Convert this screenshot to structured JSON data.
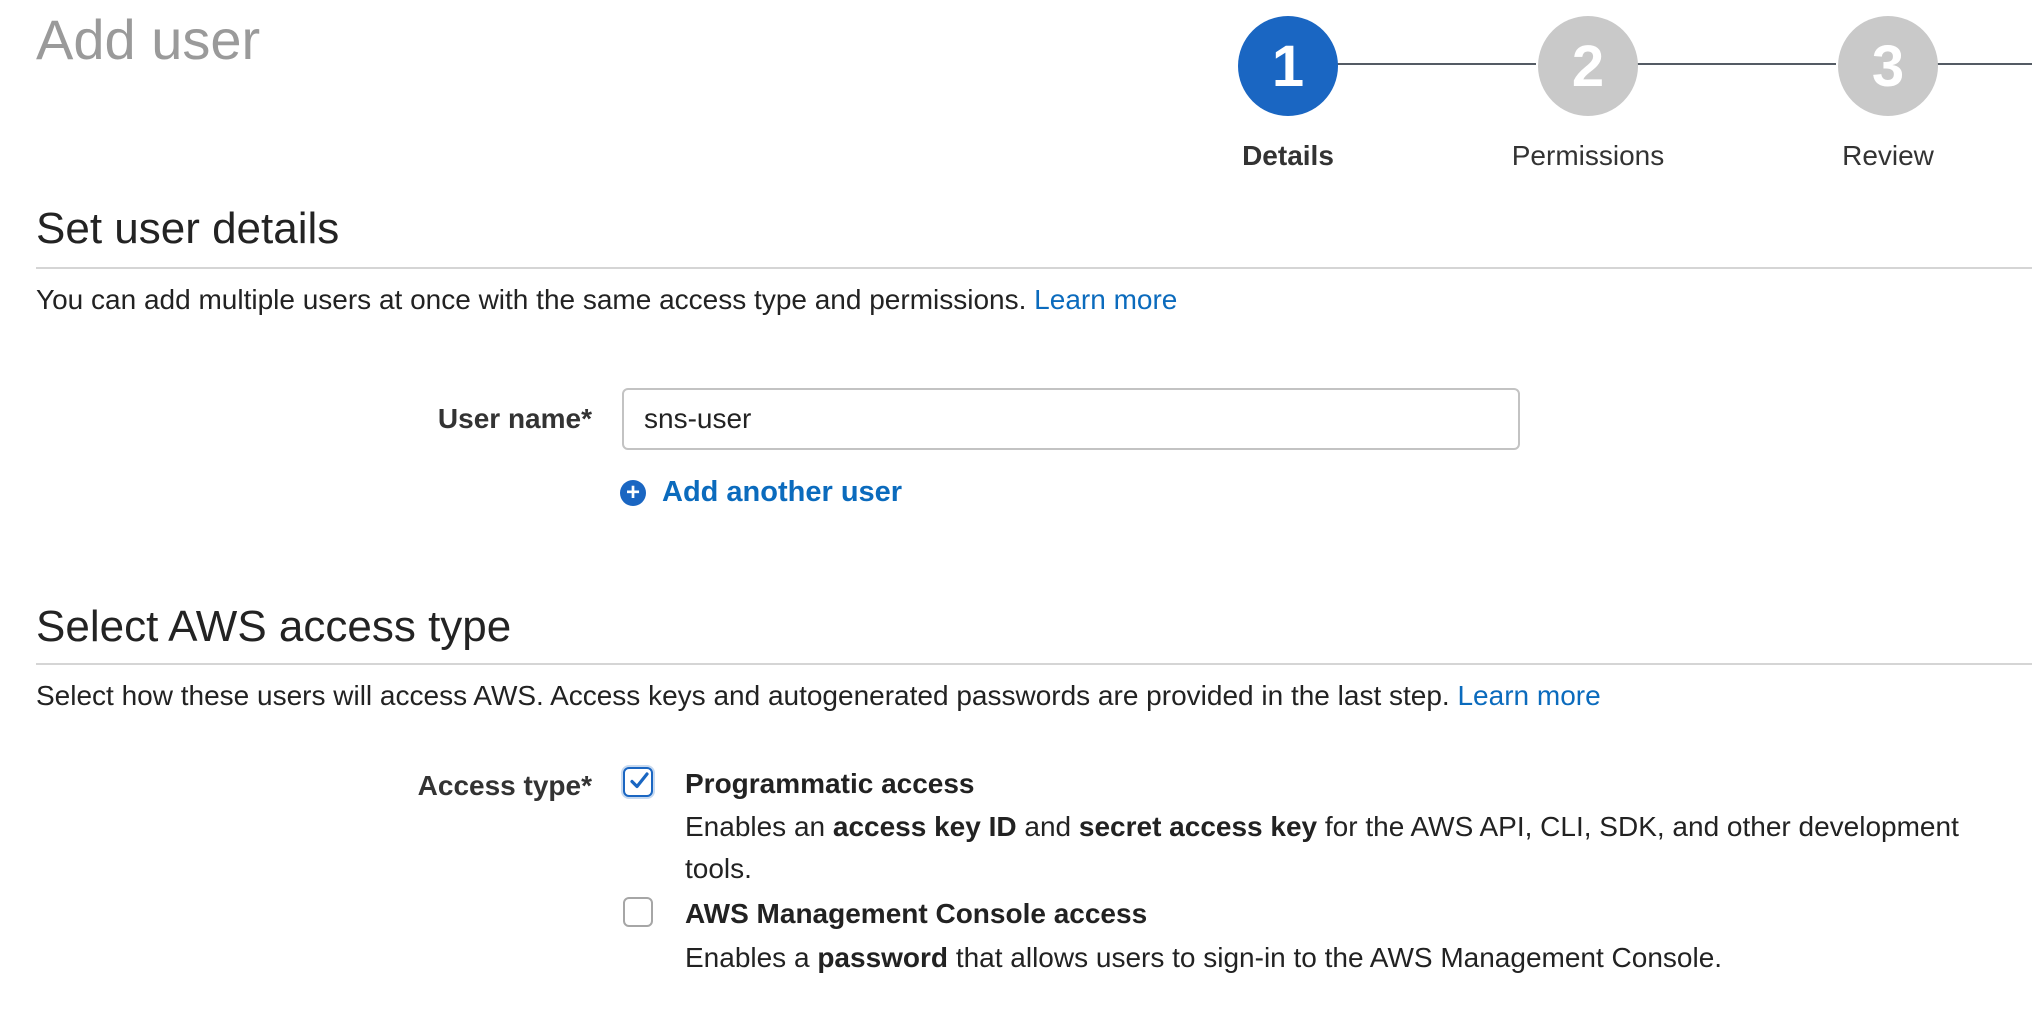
{
  "page": {
    "title": "Add user"
  },
  "stepper": {
    "steps": [
      {
        "number": "1",
        "label": "Details",
        "active": true
      },
      {
        "number": "2",
        "label": "Permissions",
        "active": false
      },
      {
        "number": "3",
        "label": "Review",
        "active": false
      }
    ]
  },
  "user_details": {
    "title": "Set user details",
    "description": "You can add multiple users at once with the same access type and permissions.",
    "learn_more": "Learn more",
    "user_name_label": "User name*",
    "user_name_value": "sns-user",
    "add_another_user": "Add another user"
  },
  "access_type": {
    "title": "Select AWS access type",
    "description": "Select how these users will access AWS. Access keys and autogenerated passwords are provided in the last step.",
    "learn_more": "Learn more",
    "label": "Access type*",
    "options": [
      {
        "title": "Programmatic access",
        "checked": true,
        "desc_prefix": "Enables an",
        "desc_bold1": "access key ID",
        "desc_mid": "and",
        "desc_bold2": "secret access key",
        "desc_suffix": "for the AWS API, CLI, SDK, and other development tools."
      },
      {
        "title": "AWS Management Console access",
        "checked": false,
        "desc_prefix": "Enables a",
        "desc_bold1": "password",
        "desc_suffix": "that allows users to sign-in to the AWS Management Console."
      }
    ]
  },
  "colors": {
    "accent": "#1a66c2",
    "link": "#0b6bbd",
    "inactive_step": "#c9c9c9"
  },
  "icons": {
    "add": "plus-circle-icon",
    "check": "check-icon"
  }
}
